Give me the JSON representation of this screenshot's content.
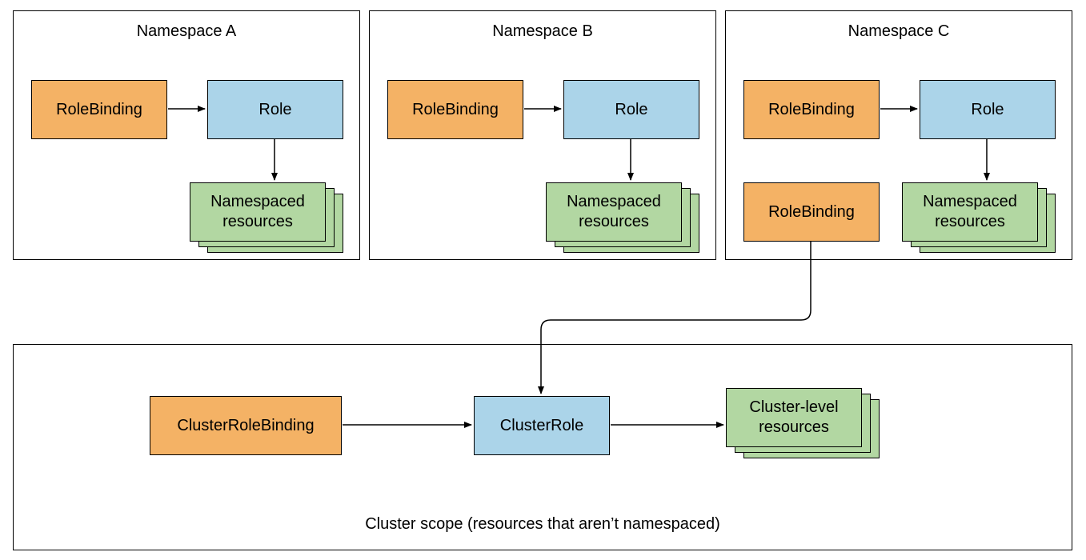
{
  "namespaces": {
    "a": {
      "title": "Namespace A",
      "rolebinding": "RoleBinding",
      "role": "Role",
      "resources": "Namespaced\nresources"
    },
    "b": {
      "title": "Namespace B",
      "rolebinding": "RoleBinding",
      "role": "Role",
      "resources": "Namespaced\nresources"
    },
    "c": {
      "title": "Namespace C",
      "rolebinding": "RoleBinding",
      "role": "Role",
      "rolebinding2": "RoleBinding",
      "resources": "Namespaced\nresources"
    }
  },
  "cluster": {
    "clusterrolebinding": "ClusterRoleBinding",
    "clusterrole": "ClusterRole",
    "resources": "Cluster-level\nresources",
    "caption": "Cluster scope (resources that aren’t namespaced)"
  }
}
